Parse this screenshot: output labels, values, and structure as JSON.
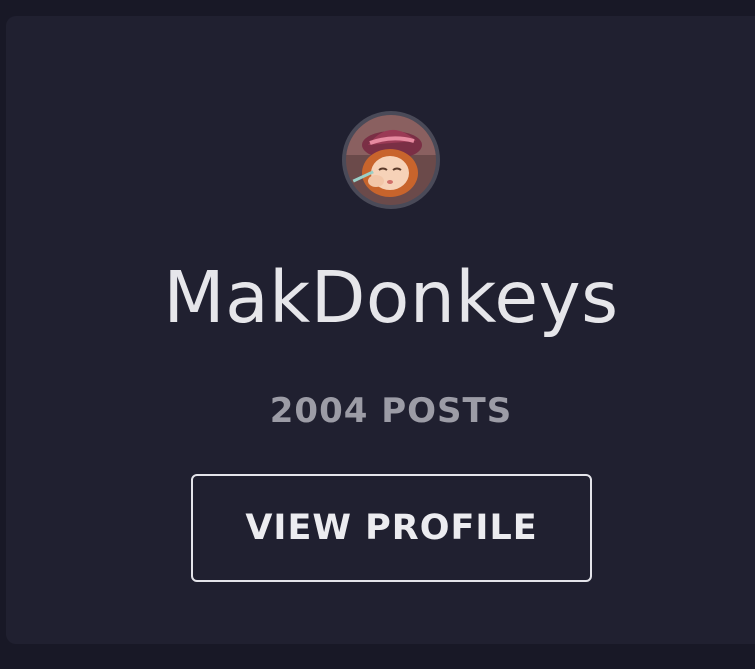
{
  "profile": {
    "avatar_icon": "avatar-anime-character-icon",
    "username": "MakDonkeys",
    "posts_label": "2004 POSTS",
    "view_profile_label": "VIEW PROFILE"
  },
  "colors": {
    "page_background": "#181826",
    "card_background": "#202030",
    "username_text": "#e6e6ea",
    "posts_text": "#9c9ca6",
    "button_border": "#e4e4ea"
  }
}
